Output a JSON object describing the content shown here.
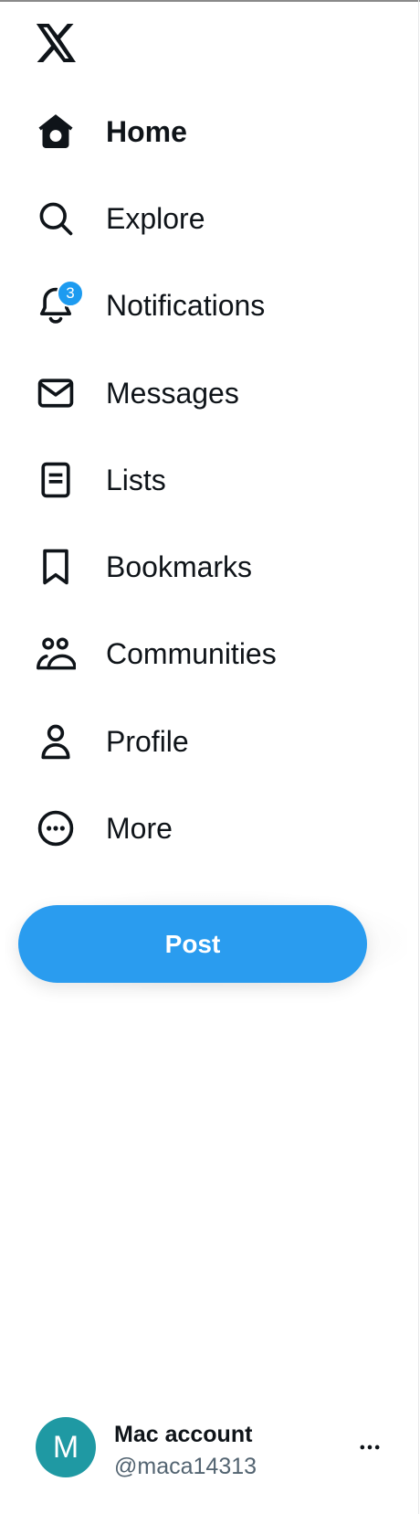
{
  "logo": {
    "icon": "x-logo-icon"
  },
  "nav": {
    "items": [
      {
        "label": "Home",
        "icon": "home-icon",
        "active": true
      },
      {
        "label": "Explore",
        "icon": "search-icon"
      },
      {
        "label": "Notifications",
        "icon": "bell-icon",
        "badge": "3"
      },
      {
        "label": "Messages",
        "icon": "envelope-icon"
      },
      {
        "label": "Lists",
        "icon": "list-icon"
      },
      {
        "label": "Bookmarks",
        "icon": "bookmark-icon"
      },
      {
        "label": "Communities",
        "icon": "people-icon"
      },
      {
        "label": "Profile",
        "icon": "person-icon"
      },
      {
        "label": "More",
        "icon": "more-circle-icon"
      }
    ]
  },
  "post_button": {
    "label": "Post"
  },
  "account": {
    "avatar_letter": "M",
    "name": "Mac account",
    "handle": "@maca14313",
    "more_icon": "ellipsis-icon"
  },
  "colors": {
    "accent": "#1d9bf0",
    "post_button": "#2a9cef",
    "avatar": "#1f99a3",
    "text": "#0f1419",
    "secondary_text": "#536471"
  }
}
